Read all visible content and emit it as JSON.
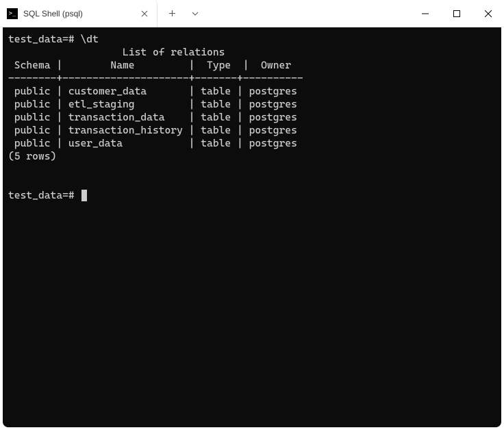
{
  "window": {
    "tab_title": "SQL Shell (psql)"
  },
  "terminal": {
    "prompt": "test_data=#",
    "command": "\\dt",
    "output_title": "List of relations",
    "columns": {
      "schema": "Schema",
      "name": "Name",
      "type": "Type",
      "owner": "Owner"
    },
    "separator": "--------+---------------------+-------+----------",
    "rows": [
      {
        "schema": "public",
        "name": "customer_data",
        "type": "table",
        "owner": "postgres"
      },
      {
        "schema": "public",
        "name": "etl_staging",
        "type": "table",
        "owner": "postgres"
      },
      {
        "schema": "public",
        "name": "transaction_data",
        "type": "table",
        "owner": "postgres"
      },
      {
        "schema": "public",
        "name": "transaction_history",
        "type": "table",
        "owner": "postgres"
      },
      {
        "schema": "public",
        "name": "user_data",
        "type": "table",
        "owner": "postgres"
      }
    ],
    "row_count_text": "(5 rows)"
  }
}
